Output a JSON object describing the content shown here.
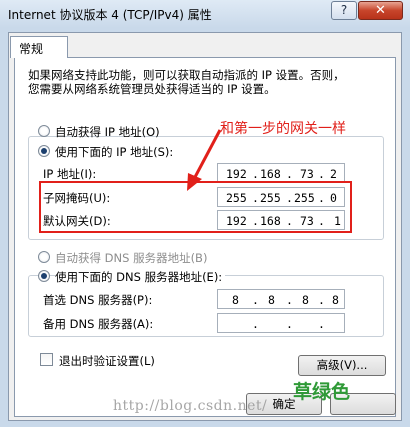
{
  "window": {
    "title": "Internet 协议版本 4 (TCP/IPv4) 属性",
    "help_label": "?",
    "close_label": "✕"
  },
  "tabs": [
    {
      "label": "常规"
    }
  ],
  "description_lines": [
    "如果网络支持此功能，则可以获取自动指派的 IP 设置。否则，",
    "您需要从网络系统管理员处获得适当的 IP 设置。"
  ],
  "ip_section": {
    "auto_label": "自动获得 IP 地址(O)",
    "manual_label": "使用下面的 IP 地址(S):",
    "auto_selected": false,
    "fields": [
      {
        "label": "IP 地址(I):",
        "octets": [
          "192",
          "168",
          "73",
          "2"
        ]
      },
      {
        "label": "子网掩码(U):",
        "octets": [
          "255",
          "255",
          "255",
          "0"
        ]
      },
      {
        "label": "默认网关(D):",
        "octets": [
          "192",
          "168",
          "73",
          "1"
        ]
      }
    ]
  },
  "dns_section": {
    "auto_label": "自动获得 DNS 服务器地址(B)",
    "manual_label": "使用下面的 DNS 服务器地址(E):",
    "auto_selected": false,
    "fields": [
      {
        "label": "首选 DNS 服务器(P):",
        "octets": [
          "8",
          "8",
          "8",
          "8"
        ]
      },
      {
        "label": "备用 DNS 服务器(A):",
        "octets": [
          "",
          "",
          "",
          ""
        ]
      }
    ]
  },
  "validate_on_exit": {
    "label": "退出时验证设置(L)",
    "checked": false
  },
  "advanced_button": "高级(V)...",
  "ok_button": "确定",
  "annotation": "和第一步的网关一样",
  "watermark": "http://blog.csdn.net/",
  "logo_text": "草绿色",
  "colors": {
    "annotation": "#e1201a",
    "logo": "#2f9a37",
    "window_frame": "#c9d9ea"
  }
}
